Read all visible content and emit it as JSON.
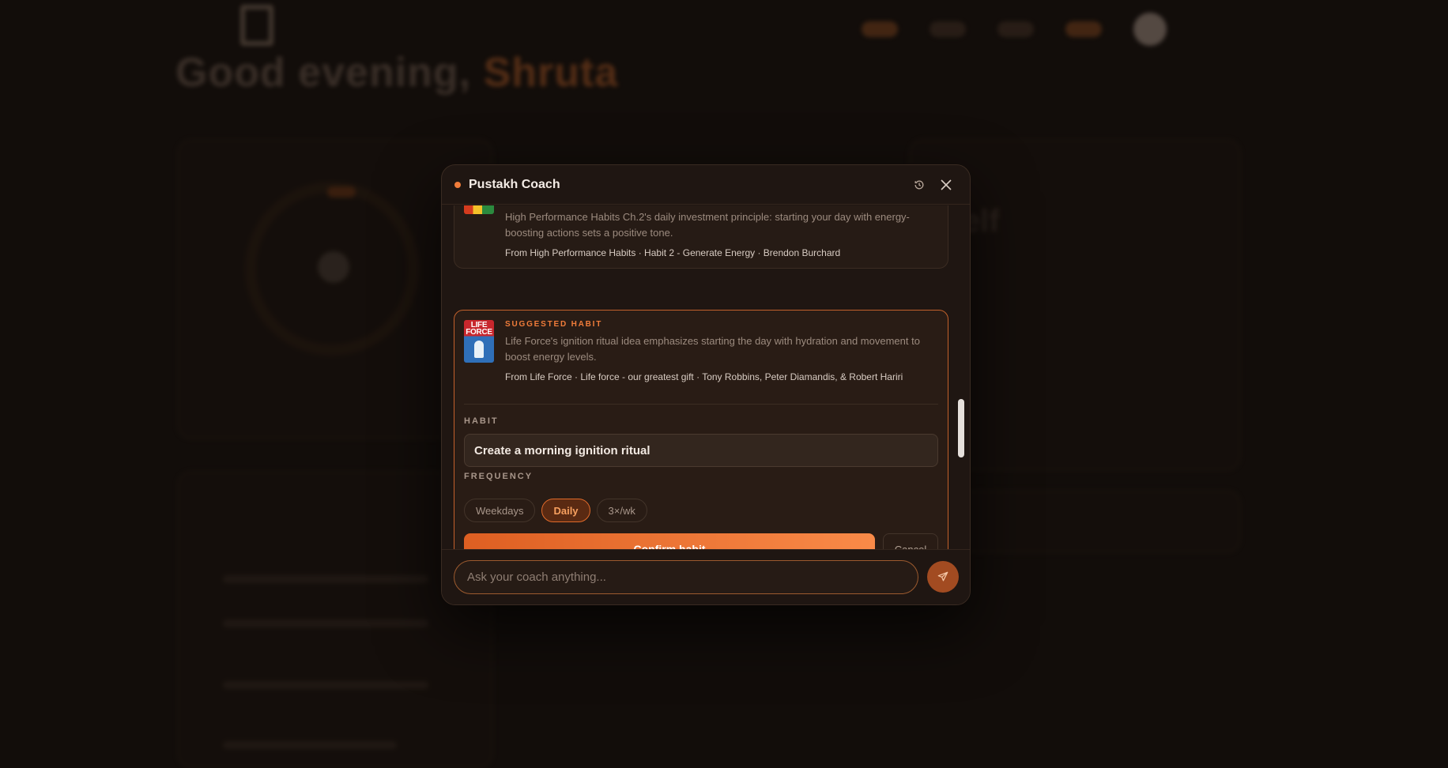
{
  "modal": {
    "title": "Pustakh Coach",
    "icons": {
      "status": "status-dot",
      "history": "history-icon",
      "close": "close-icon",
      "send": "send-icon"
    }
  },
  "prev_card": {
    "description": "High Performance Habits Ch.2's daily investment principle: starting your day with energy-boosting actions sets a positive tone.",
    "source": "From High Performance Habits · Habit 2 - Generate Energy · Brendon Burchard"
  },
  "suggested_card": {
    "label": "SUGGESTED HABIT",
    "cover_text": "LIFE FORCE",
    "description": "Life Force's ignition ritual idea emphasizes starting the day with hydration and movement to boost energy levels.",
    "source": "From Life Force · Life force - our greatest gift · Tony Robbins, Peter Diamandis, & Robert Hariri",
    "habit_label": "HABIT",
    "habit_value": "Create a morning ignition ritual",
    "frequency_label": "FREQUENCY",
    "frequency_options": [
      "Weekdays",
      "Daily",
      "3×/wk"
    ],
    "frequency_selected": "Daily",
    "confirm_label": "Confirm habit",
    "cancel_label": "Cancel"
  },
  "composer": {
    "placeholder": "Ask your coach anything..."
  },
  "colors": {
    "accent": "#f07c3a",
    "background": "#120d0a",
    "modal": "#1f1612"
  }
}
